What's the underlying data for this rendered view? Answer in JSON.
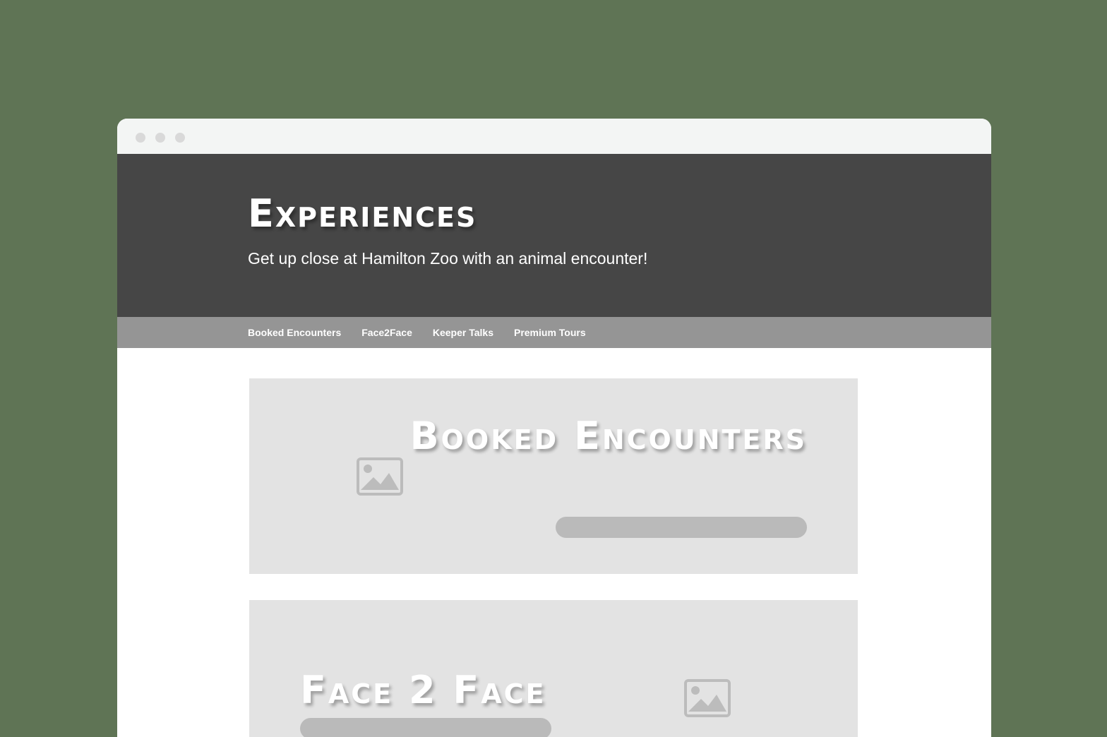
{
  "window": {
    "controls": [
      "window-dot",
      "window-dot",
      "window-dot"
    ]
  },
  "hero": {
    "title": "Experiences",
    "subtitle": "Get up close at Hamilton Zoo with an animal encounter!"
  },
  "nav": {
    "items": [
      {
        "label": "Booked Encounters"
      },
      {
        "label": "Face2Face"
      },
      {
        "label": "Keeper Talks"
      },
      {
        "label": "Premium Tours"
      }
    ]
  },
  "cards": [
    {
      "title": "Booked Encounters",
      "icon": "image-placeholder-icon"
    },
    {
      "title": "Face 2 Face",
      "icon": "image-placeholder-icon"
    }
  ],
  "colors": {
    "page_background": "#5f7455",
    "hero_background": "#464646",
    "nav_background": "#959595",
    "card_background": "#e3e3e3",
    "pill_color": "#bababa"
  }
}
